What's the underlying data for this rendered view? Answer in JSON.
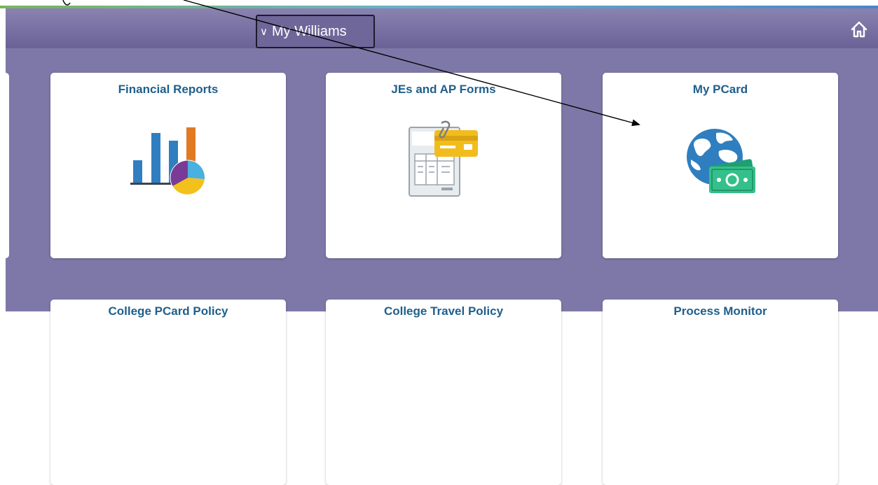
{
  "header": {
    "homepage_selector_label": "My Williams",
    "home_icon": "home-icon",
    "accent_colors": [
      "#7ab55c",
      "#6ab0c8",
      "#4a86c8"
    ],
    "bar_color": "#776fa0"
  },
  "tiles": [
    {
      "title": "Financial Reports",
      "icon": "bar-pie-chart-icon"
    },
    {
      "title": "JEs and AP Forms",
      "icon": "form-with-card-icon"
    },
    {
      "title": "My PCard",
      "icon": "globe-money-icon"
    },
    {
      "title": "College PCard Policy"
    },
    {
      "title": "College Travel Policy"
    },
    {
      "title": "Process Monitor"
    }
  ],
  "colors": {
    "tile_title": "#1f5f8b",
    "content_background": "#7e78a8"
  }
}
